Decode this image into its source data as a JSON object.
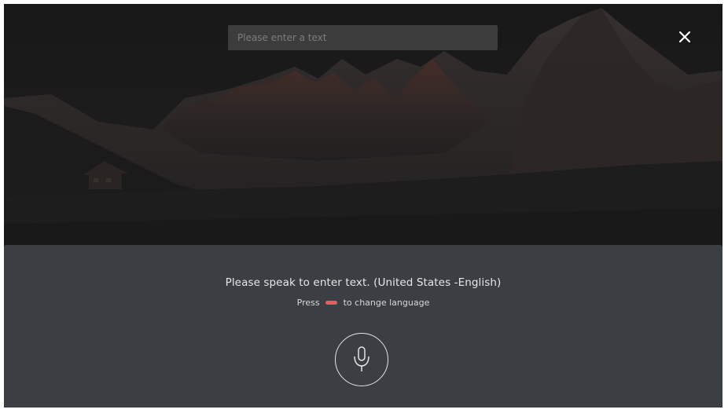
{
  "search": {
    "placeholder": "Please enter a text",
    "value": ""
  },
  "close": {
    "icon": "close-icon"
  },
  "voice": {
    "prompt": "Please speak to enter text. (United States -English)",
    "hint_prefix": "Press",
    "hint_suffix": "to change language",
    "key_icon": "red-key-icon",
    "key_color": "#e85b62",
    "mic_icon": "microphone-icon"
  },
  "colors": {
    "panel": "#3b3e42",
    "search_bg": "#3c3c3c",
    "text": "#e8e8e8"
  }
}
